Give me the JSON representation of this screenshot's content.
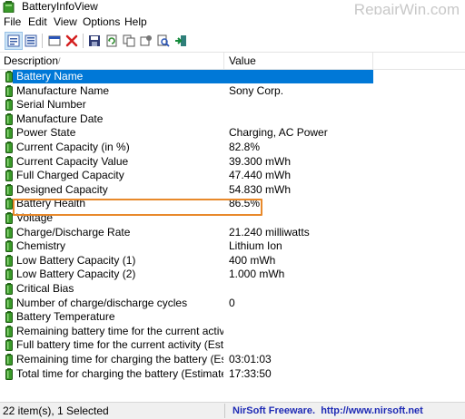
{
  "window": {
    "title": "BatteryInfoView",
    "watermark": "RepairWin.com"
  },
  "menu": [
    "File",
    "Edit",
    "View",
    "Options",
    "Help"
  ],
  "toolbar": {
    "buttons": [
      "properties-view-icon",
      "list-view-icon",
      "html-report-icon",
      "delete-icon",
      "save-icon",
      "refresh-icon",
      "copy-icon",
      "advanced-options-icon",
      "find-icon",
      "exit-icon"
    ]
  },
  "header": {
    "description": "Description",
    "sort_indicator": "/",
    "value": "Value"
  },
  "rows": [
    {
      "desc": "Battery Name",
      "value": ""
    },
    {
      "desc": "Manufacture Name",
      "value": "Sony Corp."
    },
    {
      "desc": "Serial Number",
      "value": ""
    },
    {
      "desc": "Manufacture Date",
      "value": ""
    },
    {
      "desc": "Power State",
      "value": "Charging, AC Power"
    },
    {
      "desc": "Current Capacity (in %)",
      "value": "82.8%"
    },
    {
      "desc": "Current Capacity Value",
      "value": "39.300 mWh"
    },
    {
      "desc": "Full Charged Capacity",
      "value": "47.440 mWh"
    },
    {
      "desc": "Designed Capacity",
      "value": "54.830 mWh"
    },
    {
      "desc": "Battery Health",
      "value": "86.5%"
    },
    {
      "desc": "Voltage",
      "value": ""
    },
    {
      "desc": "Charge/Discharge Rate",
      "value": "21.240 milliwatts"
    },
    {
      "desc": "Chemistry",
      "value": "Lithium Ion"
    },
    {
      "desc": "Low Battery Capacity (1)",
      "value": "400 mWh"
    },
    {
      "desc": "Low Battery Capacity (2)",
      "value": "1.000 mWh"
    },
    {
      "desc": "Critical Bias",
      "value": ""
    },
    {
      "desc": "Number of charge/discharge cycles",
      "value": "0"
    },
    {
      "desc": "Battery Temperature",
      "value": ""
    },
    {
      "desc": "Remaining battery time for the current activity (Est...",
      "value": ""
    },
    {
      "desc": "Full battery time for the current activity (Estimated)",
      "value": ""
    },
    {
      "desc": "Remaining time for charging the battery (Estimated)",
      "value": "03:01:03"
    },
    {
      "desc": "Total  time for charging the battery (Estimated)",
      "value": "17:33:50"
    }
  ],
  "selected_row": 0,
  "highlighted_row": 9,
  "status": {
    "items": "22 item(s), 1 Selected",
    "credit": "NirSoft Freeware.  http://www.nirsoft.net"
  },
  "colors": {
    "selection": "#0078d7",
    "highlight_border": "#e8892b",
    "battery_green": "#3a9a2a",
    "credit_link": "#1f2bb5"
  }
}
